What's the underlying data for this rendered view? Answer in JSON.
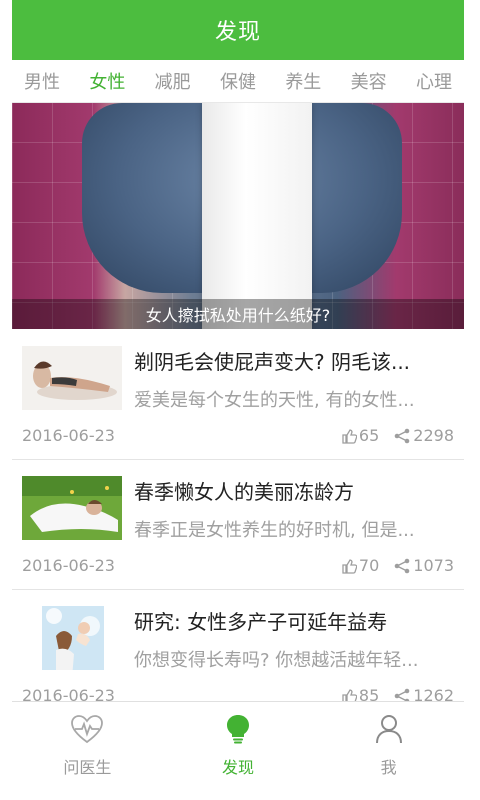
{
  "header": {
    "title": "发现"
  },
  "categories": [
    "男性",
    "女性",
    "减肥",
    "保健",
    "养生",
    "美容",
    "心理"
  ],
  "active_category_index": 1,
  "hero": {
    "caption": "女人擦拭私处用什么纸好?"
  },
  "articles": [
    {
      "title": "剃阴毛会使屁声变大? 阴毛该...",
      "summary": "爱美是每个女生的天性, 有的女性...",
      "date": "2016-06-23",
      "likes": "65",
      "shares": "2298",
      "thumb_icon": "reclining-woman-photo"
    },
    {
      "title": "春季懒女人的美丽冻龄方",
      "summary": "春季正是女性养生的好时机, 但是...",
      "date": "2016-06-23",
      "likes": "70",
      "shares": "1073",
      "thumb_icon": "woman-on-grass-photo"
    },
    {
      "title": "研究: 女性多产子可延年益寿",
      "summary": "你想变得长寿吗? 你想越活越年轻...",
      "date": "2016-06-23",
      "likes": "85",
      "shares": "1262",
      "thumb_icon": "mother-baby-photo"
    }
  ],
  "tabbar": {
    "items": [
      {
        "label": "问医生",
        "icon": "heart-pulse-icon"
      },
      {
        "label": "发现",
        "icon": "lightbulb-icon"
      },
      {
        "label": "我",
        "icon": "person-icon"
      }
    ],
    "active_index": 1
  },
  "colors": {
    "accent": "#4cbd3f",
    "active_text": "#43b233",
    "muted": "#9a9a9a"
  }
}
